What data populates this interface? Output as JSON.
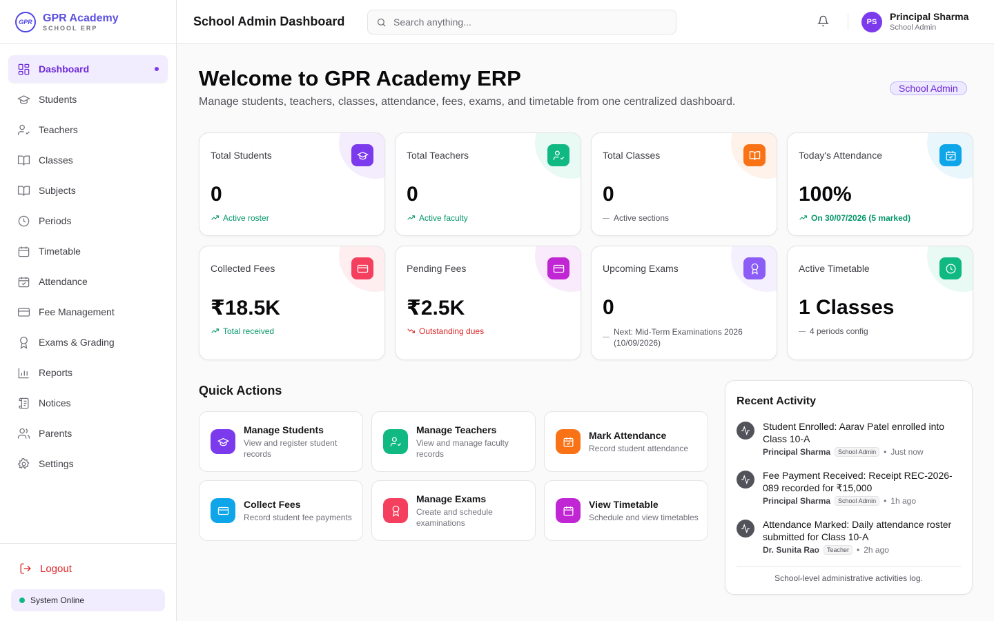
{
  "brand": {
    "name": "GPR Academy",
    "sub": "SCHOOL ERP",
    "logo_text": "GPR"
  },
  "sidebar": {
    "items": [
      {
        "label": "Dashboard",
        "icon": "dashboard-icon"
      },
      {
        "label": "Students",
        "icon": "graduation-cap-icon"
      },
      {
        "label": "Teachers",
        "icon": "user-check-icon"
      },
      {
        "label": "Classes",
        "icon": "book-open-icon"
      },
      {
        "label": "Subjects",
        "icon": "book-icon"
      },
      {
        "label": "Periods",
        "icon": "clock-icon"
      },
      {
        "label": "Timetable",
        "icon": "calendar-icon"
      },
      {
        "label": "Attendance",
        "icon": "calendar-check-icon"
      },
      {
        "label": "Fee Management",
        "icon": "credit-card-icon"
      },
      {
        "label": "Exams & Grading",
        "icon": "award-icon"
      },
      {
        "label": "Reports",
        "icon": "bar-chart-icon"
      },
      {
        "label": "Notices",
        "icon": "scroll-icon"
      },
      {
        "label": "Parents",
        "icon": "users-icon"
      },
      {
        "label": "Settings",
        "icon": "gear-icon"
      }
    ],
    "logout_label": "Logout",
    "status_label": "System Online"
  },
  "header": {
    "title": "School Admin Dashboard",
    "search_placeholder": "Search anything...",
    "user_initials": "PS",
    "user_name": "Principal Sharma",
    "user_role": "School Admin"
  },
  "main": {
    "welcome_title": "Welcome to GPR Academy ERP",
    "welcome_sub": "Manage students, teachers, classes, attendance, fees, exams, and timetable from one centralized dashboard.",
    "role_badge": "School Admin"
  },
  "stats": [
    {
      "label": "Total Students",
      "value": "0",
      "note": "Active roster",
      "trend": "up",
      "color": "#7c3aed"
    },
    {
      "label": "Total Teachers",
      "value": "0",
      "note": "Active faculty",
      "trend": "up",
      "color": "#10b981"
    },
    {
      "label": "Total Classes",
      "value": "0",
      "note": "Active sections",
      "trend": "neutral",
      "color": "#f97316"
    },
    {
      "label": "Today's Attendance",
      "value": "100%",
      "note": "On 30/07/2026 (5 marked)",
      "trend": "up",
      "color": "#0ea5e9"
    },
    {
      "label": "Collected Fees",
      "value": "₹18.5K",
      "note": "Total received",
      "trend": "up",
      "color": "#f43f5e"
    },
    {
      "label": "Pending Fees",
      "value": "₹2.5K",
      "note": "Outstanding dues",
      "trend": "down",
      "color": "#c026d3"
    },
    {
      "label": "Upcoming Exams",
      "value": "0",
      "note": "Next: Mid-Term Examinations 2026 (10/09/2026)",
      "trend": "neutral",
      "color": "#8b5cf6"
    },
    {
      "label": "Active Timetable",
      "value": "1 Classes",
      "note": "4 periods config",
      "trend": "neutral",
      "color": "#10b981"
    }
  ],
  "quick_actions": {
    "title": "Quick Actions",
    "items": [
      {
        "title": "Manage Students",
        "desc": "View and register student records",
        "color": "#7c3aed"
      },
      {
        "title": "Manage Teachers",
        "desc": "View and manage faculty records",
        "color": "#10b981"
      },
      {
        "title": "Mark Attendance",
        "desc": "Record student attendance",
        "color": "#f97316"
      },
      {
        "title": "Collect Fees",
        "desc": "Record student fee payments",
        "color": "#0ea5e9"
      },
      {
        "title": "Manage Exams",
        "desc": "Create and schedule examinations",
        "color": "#f43f5e"
      },
      {
        "title": "View Timetable",
        "desc": "Schedule and view timetables",
        "color": "#c026d3"
      }
    ]
  },
  "activity": {
    "title": "Recent Activity",
    "items": [
      {
        "text": "Student Enrolled: Aarav Patel enrolled into Class 10-A",
        "who": "Principal Sharma",
        "tag": "School Admin",
        "time": "Just now"
      },
      {
        "text": "Fee Payment Received: Receipt REC-2026-089 recorded for ₹15,000",
        "who": "Principal Sharma",
        "tag": "School Admin",
        "time": "1h ago"
      },
      {
        "text": "Attendance Marked: Daily attendance roster submitted for Class 10-A",
        "who": "Dr. Sunita Rao",
        "tag": "Teacher",
        "time": "2h ago"
      }
    ],
    "footer": "School-level administrative activities log."
  }
}
